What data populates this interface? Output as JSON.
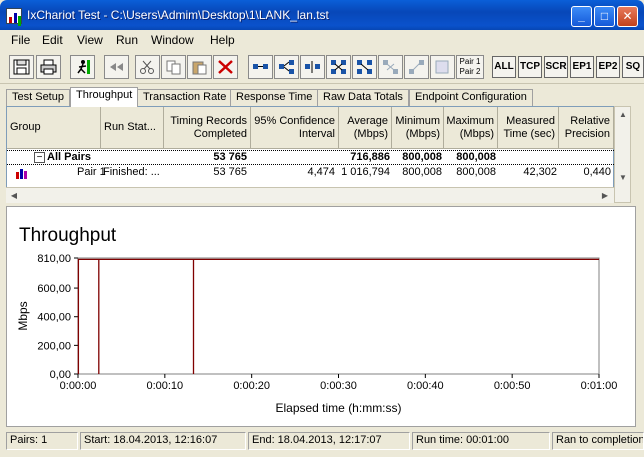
{
  "window": {
    "title": "IxChariot Test - C:\\Users\\Admim\\Desktop\\1\\LANK_lan.tst"
  },
  "menu": [
    "File",
    "Edit",
    "View",
    "Run",
    "Window",
    "Help"
  ],
  "toolbar": {
    "pair_label_1": "Pair 1",
    "pair_label_2": "Pair 2",
    "text_buttons": [
      "ALL",
      "TCP",
      "SCR",
      "EP1",
      "EP2",
      "SQ"
    ]
  },
  "tabs": [
    "Test Setup",
    "Throughput",
    "Transaction Rate",
    "Response Time",
    "Raw Data Totals",
    "Endpoint Configuration"
  ],
  "active_tab": "Throughput",
  "grid": {
    "columns": [
      "Group",
      "Run Stat...",
      "Timing Records Completed",
      "95% Confidence Interval",
      "Average (Mbps)",
      "Minimum (Mbps)",
      "Maximum (Mbps)",
      "Measured Time (sec)",
      "Relative Precision"
    ],
    "all_pairs": {
      "expander": "−",
      "label": "All Pairs",
      "records": "53 765",
      "average": "716,886",
      "minimum": "800,008",
      "maximum": "800,008"
    },
    "pair1": {
      "label": "Pair 1",
      "status": "Finished: ...",
      "records": "53 765",
      "confidence": "4,474",
      "average": "1 016,794",
      "minimum": "800,008",
      "maximum": "800,008",
      "measured": "42,302",
      "precision": "0,440"
    }
  },
  "chart_data": {
    "type": "line",
    "title": "Throughput",
    "xlabel": "Elapsed time (h:mm:ss)",
    "ylabel": "Mbps",
    "ylim": [
      0,
      810
    ],
    "xlim_seconds": [
      0,
      60
    ],
    "y_ticks": [
      "0,00",
      "200,00",
      "400,00",
      "600,00",
      "810,00"
    ],
    "x_ticks": [
      "0:00:00",
      "0:00:10",
      "0:00:20",
      "0:00:30",
      "0:00:40",
      "0:00:50",
      "0:01:00"
    ],
    "series": [
      {
        "color": "#800000",
        "x_seconds": [
          0.05,
          0.05,
          2.4,
          2.4,
          2.4,
          13.3,
          13.3,
          13.3,
          60
        ],
        "y": [
          0,
          800,
          800,
          0,
          800,
          800,
          0,
          800,
          800
        ]
      }
    ]
  },
  "status": {
    "pairs": "Pairs: 1",
    "start": "Start: 18.04.2013, 12:16:07",
    "end": "End: 18.04.2013, 12:17:07",
    "run_time": "Run time: 00:01:00",
    "result": "Ran to completion"
  },
  "colors": {
    "title_bar": "#0a52cc",
    "series": "#800000"
  }
}
